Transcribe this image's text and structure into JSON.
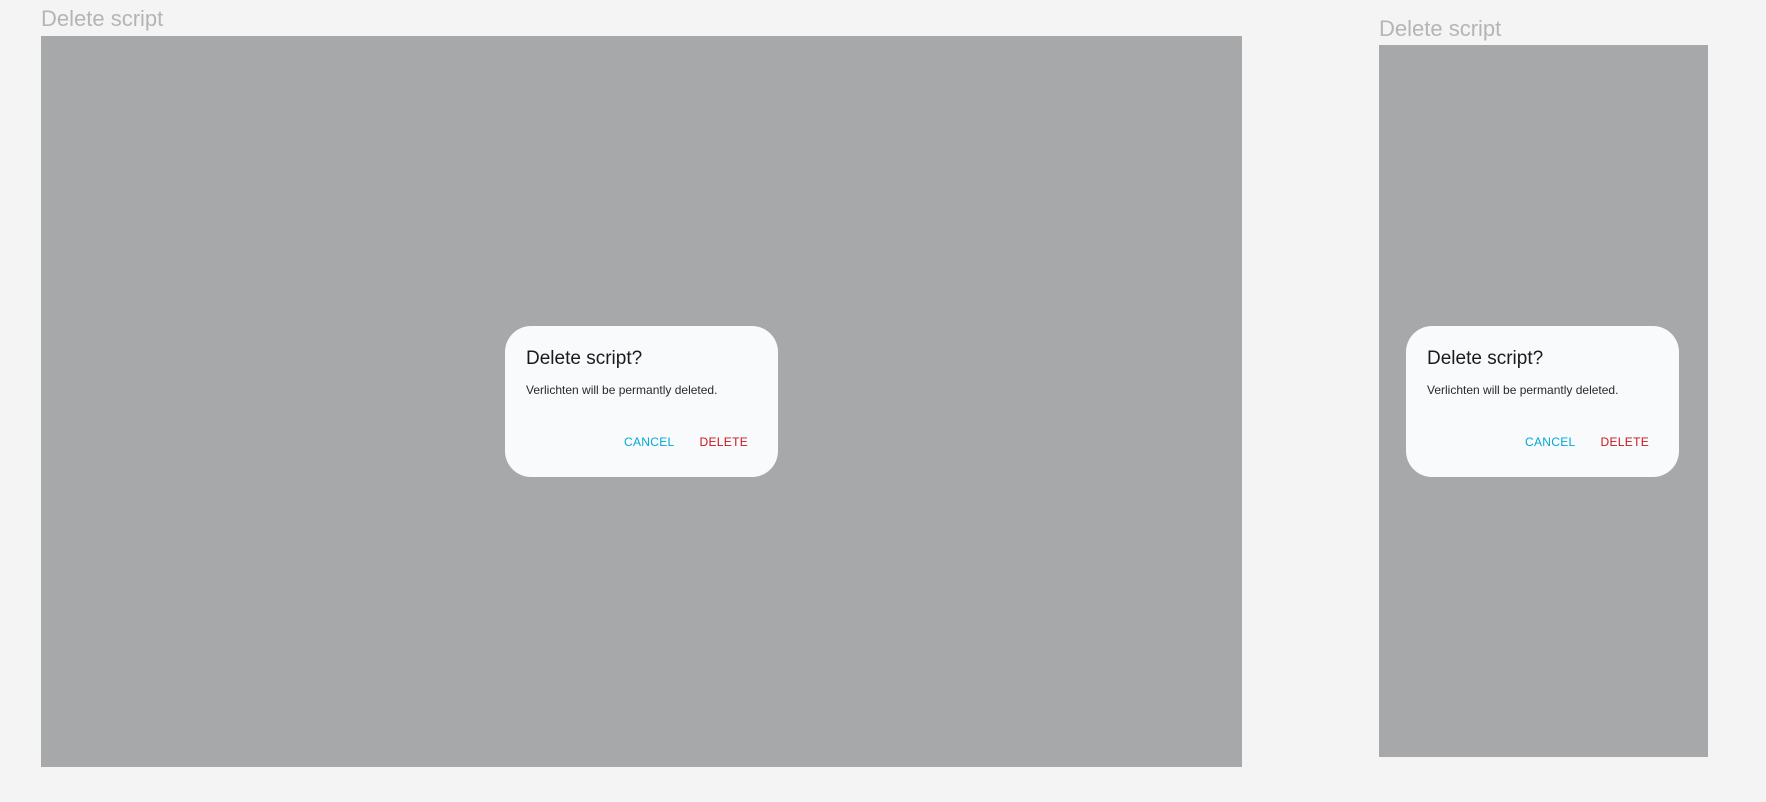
{
  "frames": [
    {
      "label": "Delete script",
      "dialog": {
        "title": "Delete script?",
        "message": "Verlichten will be permantly deleted.",
        "cancel_label": "CANCEL",
        "delete_label": "DELETE"
      }
    },
    {
      "label": "Delete script",
      "dialog": {
        "title": "Delete script?",
        "message": "Verlichten will be permantly deleted.",
        "cancel_label": "CANCEL",
        "delete_label": "DELETE"
      }
    }
  ],
  "colors": {
    "cancel": "#00a7d9",
    "delete": "#c8151d",
    "scrim": "#a7a8a9",
    "dialog_bg": "#f9fafc"
  }
}
